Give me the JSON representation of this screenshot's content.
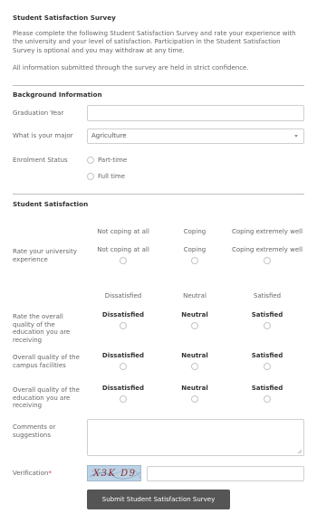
{
  "form": {
    "title": "Student Satisfaction Survey",
    "intro_1": "Please complete the following Student Satisfaction Survey and rate your experience with the university and your level of satisfaction. Participation in the Student Satisfaction Survey is optional and you may withdraw at any time.",
    "intro_2": "All information submitted through the survey are held in strict confidence."
  },
  "background": {
    "heading": "Background Information",
    "graduation_label": "Graduation Year",
    "graduation_value": "",
    "major_label": "What is your major",
    "major_value": "Agriculture",
    "enrolment_label": "Enrolment Status",
    "enrolment_options": [
      "Part-time",
      "Full time"
    ]
  },
  "satisfaction": {
    "heading": "Student Satisfaction",
    "scale1_headers": [
      "Not coping at all",
      "Coping",
      "Coping extremely well"
    ],
    "q1": {
      "label": "Rate your university experience",
      "options": [
        "Not coping at all",
        "Coping",
        "Coping extremely well"
      ]
    },
    "scale2_headers": [
      "Dissatisfied",
      "Neutral",
      "Satisfied"
    ],
    "q2": {
      "label": "Rate the overall quality of the education you are receiving",
      "options": [
        "Dissatisfied",
        "Neutral",
        "Satisfied"
      ]
    },
    "q3": {
      "label": "Overall quality of the campus facilities",
      "options": [
        "Dissatisfied",
        "Neutral",
        "Satisfied"
      ]
    },
    "q4": {
      "label": "Overall quality of the education you are receiving",
      "options": [
        "Dissatisfied",
        "Neutral",
        "Satisfied"
      ]
    },
    "comments_label": "Comments or suggestions",
    "comments_value": "",
    "verification_label": "Verification",
    "required_mark": "*",
    "captcha_text": "X3K D9",
    "submit_label": "Submit Student Satisfaction Survey"
  }
}
